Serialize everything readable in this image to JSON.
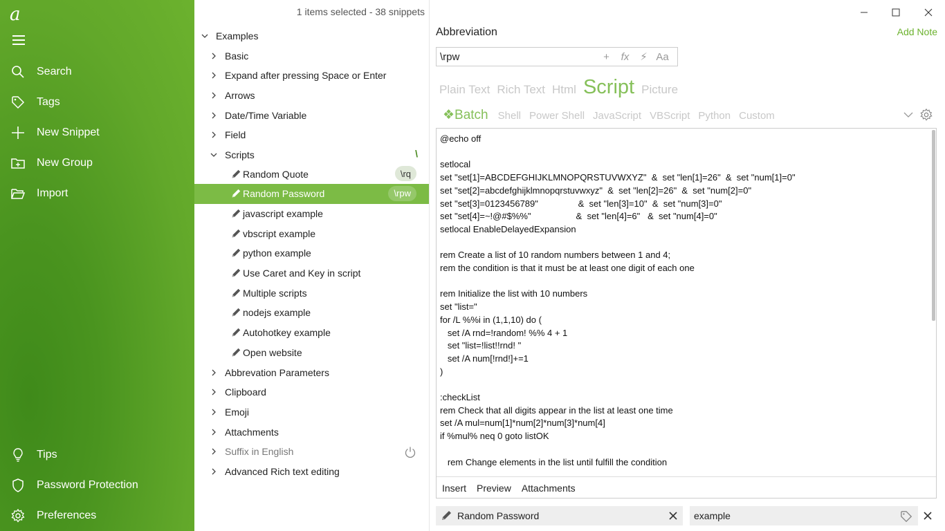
{
  "sidebar": {
    "logo": "a",
    "items": [
      {
        "label": "Search"
      },
      {
        "label": "Tags"
      },
      {
        "label": "New Snippet"
      },
      {
        "label": "New Group"
      },
      {
        "label": "Import"
      }
    ],
    "bottom": [
      {
        "label": "Tips"
      },
      {
        "label": "Password Protection"
      },
      {
        "label": "Preferences"
      }
    ]
  },
  "tree": {
    "status": "1 items selected - 38 snippets",
    "root": "Examples",
    "groups_top": [
      "Basic",
      "Expand after pressing Space or Enter",
      "Arrows",
      "Date/Time Variable",
      "Field"
    ],
    "scripts_group": {
      "label": "Scripts",
      "trail": "\\"
    },
    "snippets": [
      {
        "label": "Random Quote",
        "abbr": "\\rq"
      },
      {
        "label": "Random Password",
        "abbr": "\\rpw"
      },
      {
        "label": "javascript example",
        "abbr": ""
      },
      {
        "label": "vbscript example",
        "abbr": ""
      },
      {
        "label": "python example",
        "abbr": ""
      },
      {
        "label": "Use Caret and Key in script",
        "abbr": ""
      },
      {
        "label": "Multiple scripts",
        "abbr": ""
      },
      {
        "label": "nodejs example",
        "abbr": ""
      },
      {
        "label": "Autohotkey example",
        "abbr": ""
      },
      {
        "label": "Open website",
        "abbr": ""
      }
    ],
    "groups_bottom": [
      "Abbrevation Parameters",
      "Clipboard",
      "Emoji",
      "Attachments",
      "Suffix in English",
      "Advanced Rich text editing"
    ]
  },
  "editor": {
    "title": "Abbreviation",
    "add_note": "Add Note",
    "abbr_value": "\\rpw",
    "abbr_tools": [
      "+",
      "fx",
      "⚡",
      "Aa"
    ],
    "type_tabs": [
      "Plain Text",
      "Rich Text",
      "Html",
      "Script",
      "Picture"
    ],
    "active_type": "Script",
    "lang_tabs": [
      "❖Batch",
      "Shell",
      "Power Shell",
      "JavaScript",
      "VBScript",
      "Python",
      "Custom"
    ],
    "active_lang": "❖Batch",
    "code": "@echo off\n\nsetlocal\nset \"set[1]=ABCDEFGHIJKLMNOPQRSTUVWXYZ\"  &  set \"len[1]=26\"  &  set \"num[1]=0\"\nset \"set[2]=abcdefghijklmnopqrstuvwxyz\"  &  set \"len[2]=26\"  &  set \"num[2]=0\"\nset \"set[3]=0123456789\"                &  set \"len[3]=10\"  &  set \"num[3]=0\"\nset \"set[4]=~!@#$%%\"                  &  set \"len[4]=6\"   &  set \"num[4]=0\"\nsetlocal EnableDelayedExpansion\n\nrem Create a list of 10 random numbers between 1 and 4;\nrem the condition is that it must be at least one digit of each one\n\nrem Initialize the list with 10 numbers\nset \"list=\"\nfor /L %%i in (1,1,10) do (\n   set /A rnd=!random! %% 4 + 1\n   set \"list=!list!!rnd! \"\n   set /A num[!rnd!]+=1\n)\n\n:checkList\nrem Check that all digits appear in the list at least one time\nset /A mul=num[1]*num[2]*num[3]*num[4]\nif %mul% neq 0 goto listOK\n\n   rem Change elements in the list until fulfill the condition",
    "bottom_tabs": [
      "Insert",
      "Preview",
      "Attachments"
    ],
    "snippet_name": "Random Password",
    "tags_value": "example"
  }
}
